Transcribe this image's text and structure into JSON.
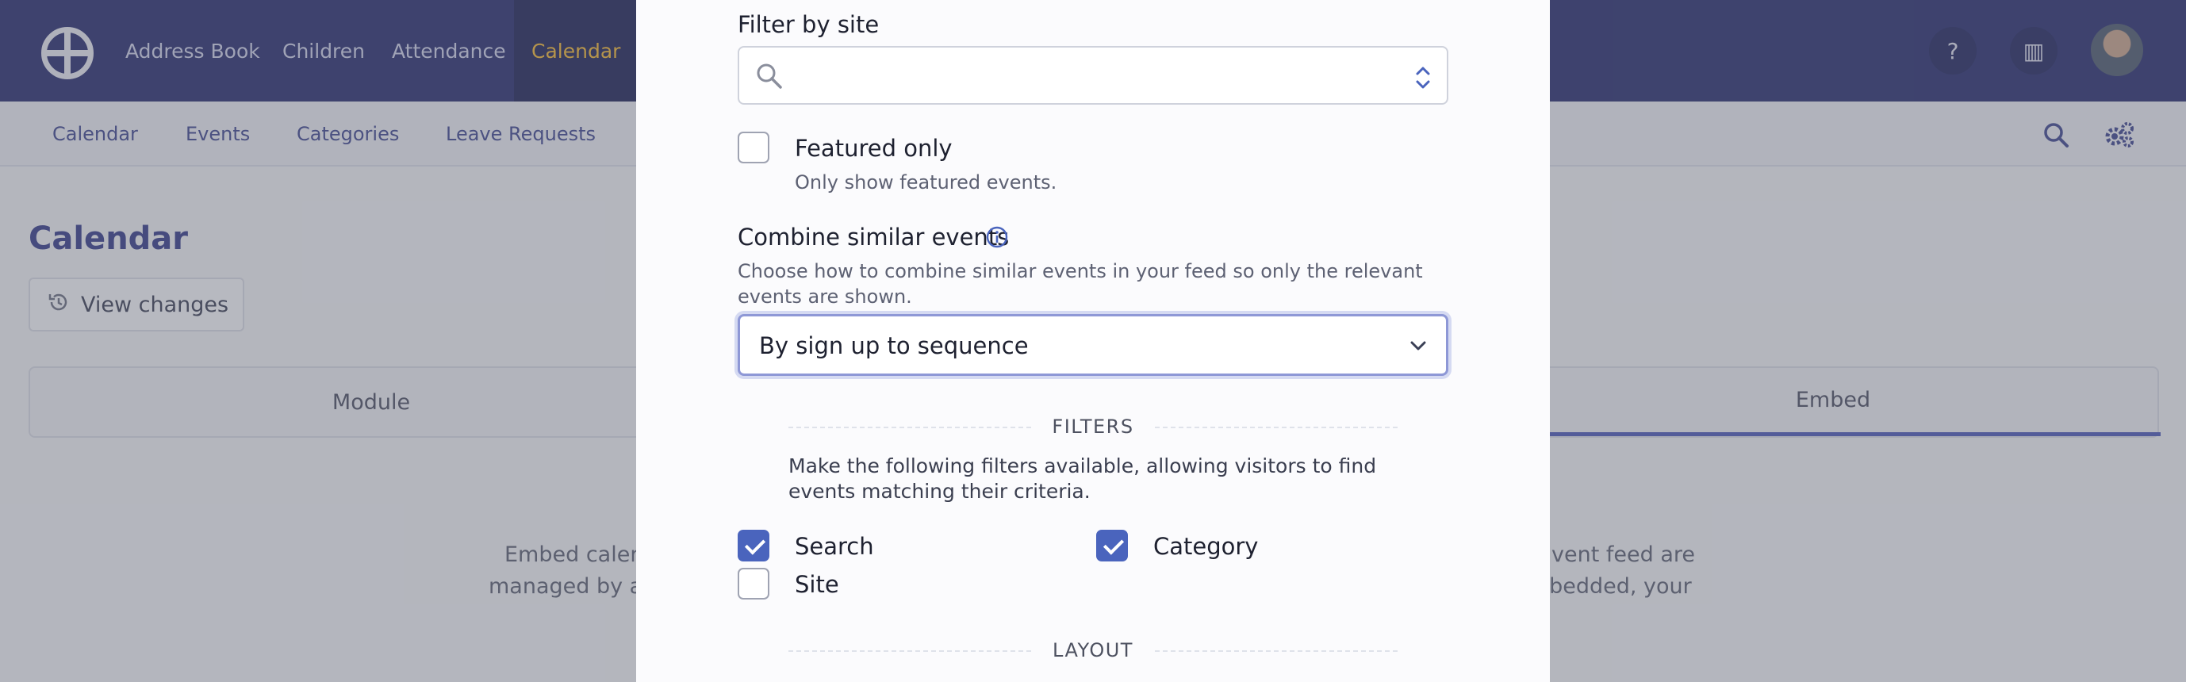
{
  "app": {
    "nav": [
      "Address Book",
      "Children",
      "Attendance",
      "Calendar"
    ],
    "active_nav": "Calendar",
    "subnav": [
      "Calendar",
      "Events",
      "Categories",
      "Leave Requests"
    ],
    "page_title": "Calendar",
    "view_changes": "View changes",
    "tabs": [
      "Module",
      "Embed"
    ],
    "embed_text": [
      "Embed calen",
      "managed by a",
      "vent feed are",
      "nbedded, your"
    ]
  },
  "modal": {
    "filter_by_site": {
      "label": "Filter by site",
      "value": ""
    },
    "featured_only": {
      "label": "Featured only",
      "hint": "Only show featured events.",
      "checked": false
    },
    "combine": {
      "label": "Combine similar events",
      "hint": "Choose how to combine similar events in your feed so only the relevant events are shown.",
      "value": "By sign up to sequence"
    },
    "filters": {
      "title": "FILTERS",
      "hint": "Make the following filters available, allowing visitors to find events matching their criteria.",
      "options": [
        {
          "label": "Search",
          "checked": true
        },
        {
          "label": "Category",
          "checked": true
        },
        {
          "label": "Site",
          "checked": false
        }
      ]
    },
    "layout": {
      "title": "LAYOUT"
    }
  },
  "colors": {
    "topbar": "#262c6e",
    "accent": "#4a64bd",
    "active_nav": "#f3b934"
  }
}
